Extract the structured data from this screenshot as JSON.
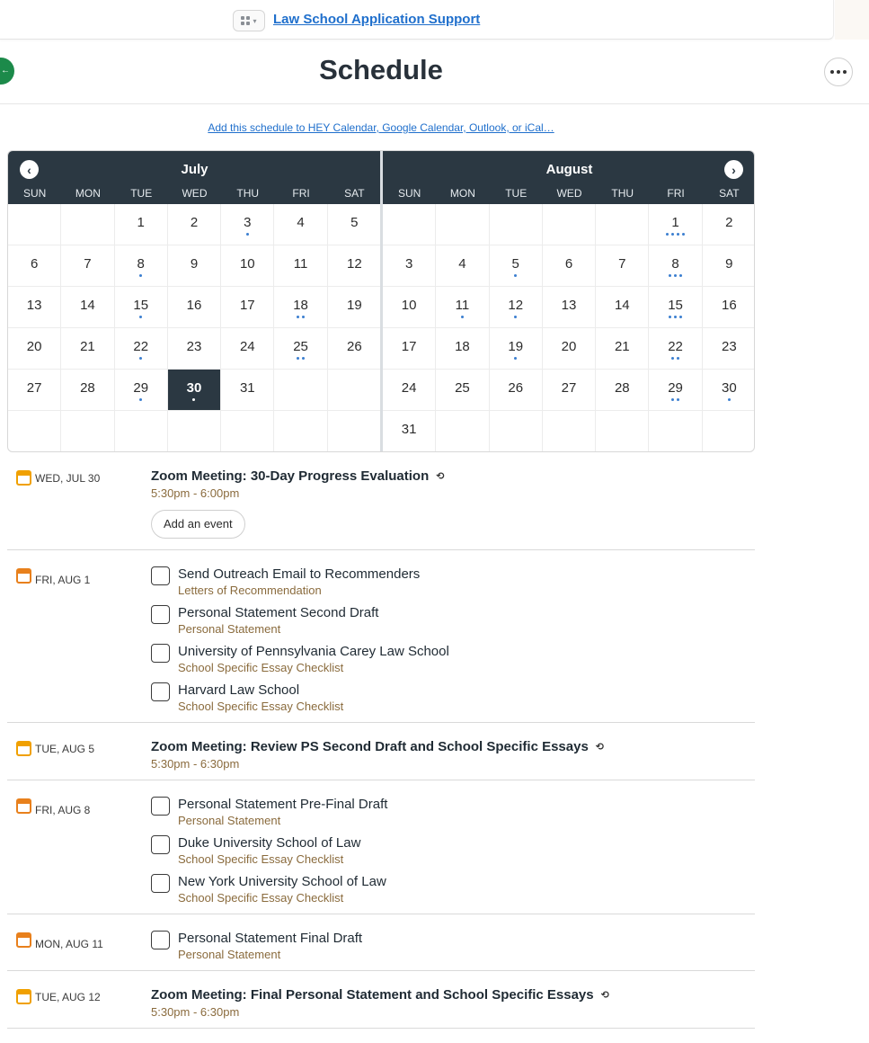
{
  "topbar": {
    "project_link": "Law School Application Support",
    "switcher_icon": "grid-icon"
  },
  "header": {
    "title": "Schedule",
    "more_icon": "ellipsis-icon"
  },
  "subscribe_link": "Add this schedule to HEY Calendar, Google Calendar, Outlook, or iCal…",
  "calendar": {
    "weekdays": [
      "SUN",
      "MON",
      "TUE",
      "WED",
      "THU",
      "FRI",
      "SAT"
    ],
    "months": [
      {
        "name": "July",
        "weeks": [
          [
            {
              "d": ""
            },
            {
              "d": ""
            },
            {
              "d": "1"
            },
            {
              "d": "2"
            },
            {
              "d": "3",
              "dots": 1
            },
            {
              "d": "4"
            },
            {
              "d": "5"
            }
          ],
          [
            {
              "d": "6"
            },
            {
              "d": "7"
            },
            {
              "d": "8",
              "dots": 1
            },
            {
              "d": "9"
            },
            {
              "d": "10"
            },
            {
              "d": "11"
            },
            {
              "d": "12"
            }
          ],
          [
            {
              "d": "13"
            },
            {
              "d": "14"
            },
            {
              "d": "15",
              "dots": 1
            },
            {
              "d": "16"
            },
            {
              "d": "17"
            },
            {
              "d": "18",
              "dots": 2
            },
            {
              "d": "19"
            }
          ],
          [
            {
              "d": "20"
            },
            {
              "d": "21"
            },
            {
              "d": "22",
              "dots": 1
            },
            {
              "d": "23"
            },
            {
              "d": "24"
            },
            {
              "d": "25",
              "dots": 2
            },
            {
              "d": "26"
            }
          ],
          [
            {
              "d": "27"
            },
            {
              "d": "28"
            },
            {
              "d": "29",
              "dots": 1
            },
            {
              "d": "30",
              "dots": 1,
              "today": true
            },
            {
              "d": "31"
            },
            {
              "d": ""
            },
            {
              "d": ""
            }
          ],
          [
            {
              "d": ""
            },
            {
              "d": ""
            },
            {
              "d": ""
            },
            {
              "d": ""
            },
            {
              "d": ""
            },
            {
              "d": ""
            },
            {
              "d": ""
            }
          ]
        ]
      },
      {
        "name": "August",
        "weeks": [
          [
            {
              "d": ""
            },
            {
              "d": ""
            },
            {
              "d": ""
            },
            {
              "d": ""
            },
            {
              "d": ""
            },
            {
              "d": "1",
              "dots": 4
            },
            {
              "d": "2"
            }
          ],
          [
            {
              "d": "3"
            },
            {
              "d": "4"
            },
            {
              "d": "5",
              "dots": 1
            },
            {
              "d": "6"
            },
            {
              "d": "7"
            },
            {
              "d": "8",
              "dots": 3
            },
            {
              "d": "9"
            }
          ],
          [
            {
              "d": "10"
            },
            {
              "d": "11",
              "dots": 1
            },
            {
              "d": "12",
              "dots": 1
            },
            {
              "d": "13"
            },
            {
              "d": "14"
            },
            {
              "d": "15",
              "dots": 3
            },
            {
              "d": "16"
            }
          ],
          [
            {
              "d": "17"
            },
            {
              "d": "18"
            },
            {
              "d": "19",
              "dots": 1
            },
            {
              "d": "20"
            },
            {
              "d": "21"
            },
            {
              "d": "22",
              "dots": 2
            },
            {
              "d": "23"
            }
          ],
          [
            {
              "d": "24"
            },
            {
              "d": "25"
            },
            {
              "d": "26"
            },
            {
              "d": "27"
            },
            {
              "d": "28"
            },
            {
              "d": "29",
              "dots": 2
            },
            {
              "d": "30",
              "dots": 1
            }
          ],
          [
            {
              "d": "31"
            },
            {
              "d": ""
            },
            {
              "d": ""
            },
            {
              "d": ""
            },
            {
              "d": ""
            },
            {
              "d": ""
            },
            {
              "d": ""
            }
          ]
        ]
      }
    ]
  },
  "agenda": [
    {
      "date": "WED, JUL 30",
      "icon": "event",
      "events": [
        {
          "title": "Zoom Meeting: 30-Day Progress Evaluation",
          "time": "5:30pm - 6:00pm",
          "recurring": true
        }
      ],
      "add_event_label": "Add an event"
    },
    {
      "date": "FRI, AUG 1",
      "icon": "todo",
      "todos": [
        {
          "title": "Send Outreach Email to Recommenders",
          "list": "Letters of Recommendation"
        },
        {
          "title": "Personal Statement Second Draft",
          "list": "Personal Statement"
        },
        {
          "title": "University of Pennsylvania Carey Law School",
          "list": "School Specific Essay Checklist"
        },
        {
          "title": "Harvard Law School",
          "list": "School Specific Essay Checklist"
        }
      ]
    },
    {
      "date": "TUE, AUG 5",
      "icon": "event",
      "events": [
        {
          "title": "Zoom Meeting: Review PS Second Draft and School Specific Essays",
          "time": "5:30pm - 6:30pm",
          "recurring": true
        }
      ]
    },
    {
      "date": "FRI, AUG 8",
      "icon": "todo",
      "todos": [
        {
          "title": "Personal Statement Pre-Final Draft",
          "list": "Personal Statement"
        },
        {
          "title": "Duke University School of Law",
          "list": "School Specific Essay Checklist"
        },
        {
          "title": "New York University School of Law",
          "list": "School Specific Essay Checklist"
        }
      ]
    },
    {
      "date": "MON, AUG 11",
      "icon": "todo",
      "todos": [
        {
          "title": "Personal Statement Final Draft",
          "list": "Personal Statement"
        }
      ]
    },
    {
      "date": "TUE, AUG 12",
      "icon": "event",
      "events": [
        {
          "title": "Zoom Meeting: Final Personal Statement and School Specific Essays",
          "time": "5:30pm - 6:30pm",
          "recurring": true
        }
      ]
    }
  ]
}
